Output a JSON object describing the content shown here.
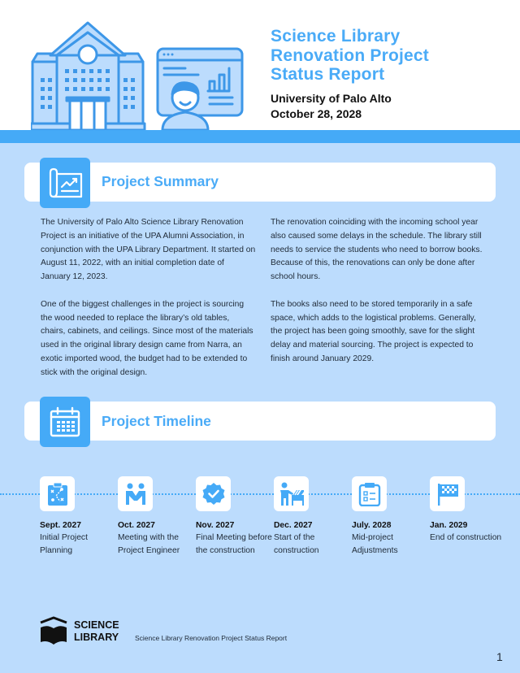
{
  "header": {
    "title_lines": [
      "Science Library",
      "Renovation Project",
      "Status Report"
    ],
    "organization": "University of Palo Alto",
    "date": "October 28, 2028"
  },
  "summary": {
    "heading": "Project Summary",
    "left_paragraphs": [
      "The University of Palo Alto Science Library Renovation Project is an initiative of the UPA Alumni Association, in conjunction with the UPA Library Department. It started on August 11, 2022, with an initial completion date of January 12, 2023.",
      "One of the biggest challenges in the project is sourcing the wood needed to replace the library’s old tables, chairs, cabinets, and ceilings. Since most of the materials used in the original library design came from Narra, an exotic imported wood, the budget had to be extended to stick with the original design."
    ],
    "right_paragraphs": [
      "The renovation coinciding with the incoming school year also caused some delays in the schedule. The library still needs to service the students who need to borrow books. Because of this, the renovations can only be done after school hours.",
      "The books also need to be stored temporarily in a safe space, which adds to the logistical problems. Generally, the project has been going smoothly, save for the slight delay and material sourcing. The project is expected to finish around January 2029."
    ]
  },
  "timeline": {
    "heading": "Project Timeline",
    "items": [
      {
        "date": "Sept. 2027",
        "description": "Initial Project Planning",
        "icon": "strategy-clipboard-icon"
      },
      {
        "date": "Oct. 2027",
        "description": "Meeting with the Project Engineer",
        "icon": "handshake-people-icon"
      },
      {
        "date": "Nov. 2027",
        "description": "Final Meeting before the construction",
        "icon": "verified-badge-icon"
      },
      {
        "date": "Dec. 2027",
        "description": "Start of the construction",
        "icon": "construction-worker-icon"
      },
      {
        "date": "July. 2028",
        "description": "Mid-project Adjustments",
        "icon": "checklist-clipboard-icon"
      },
      {
        "date": "Jan. 2029",
        "description": "End of construction",
        "icon": "finish-flag-icon"
      }
    ]
  },
  "footer": {
    "logo_line1": "SCIENCE",
    "logo_line2": "LIBRARY",
    "report_name": "Science Library Renovation Project Status Report",
    "page_number": "1"
  },
  "colors": {
    "accent": "#45aaf7",
    "title_blue": "#4aabf7",
    "background": "#bcdcfd",
    "card": "#ffffff"
  }
}
